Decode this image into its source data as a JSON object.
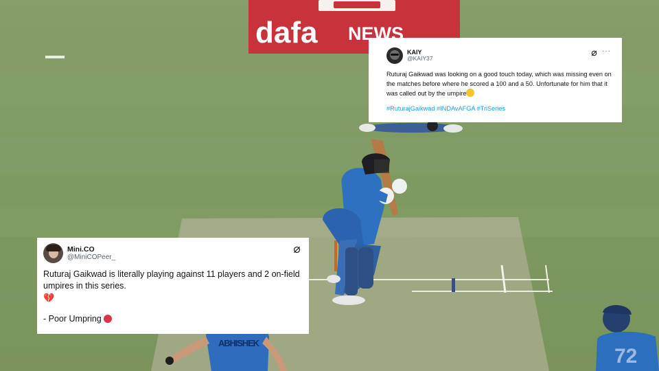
{
  "background": {
    "billboard_text": "dafaNEWS",
    "billboard_brand": "dafa",
    "billboard_suffix": "NEWS",
    "jersey_number": "72",
    "back_jersey_text": "ABHISHEK",
    "colors": {
      "grass": "#7f9a64",
      "billboard": "#c5303a",
      "jersey": "#2f74c0"
    }
  },
  "tweets": [
    {
      "id": "kaiy",
      "name": "KAIY",
      "handle": "@KAIY37",
      "body": "Ruturaj Gaikwad was looking on a good touch today, which was missing even on the matches before where he scored a 100 and a 50. Unfortunate for him that it was called out by the umpire",
      "emoji": "slightly-frowning-face",
      "hashtags": "#RuturajGaikwad #INDAvAFGA #TriSeries",
      "menu_icon": "more-dots-icon",
      "grok_icon": "grok-icon"
    },
    {
      "id": "minico",
      "name": "Mini.CO",
      "handle": "@MiniCOPeer_",
      "body": "Ruturaj Gaikwad is literally playing against 11 players and 2 on-field umpires in this series.",
      "emoji_line": "💔",
      "sign": "- Poor Umpring",
      "sign_emoji": "angry-face",
      "grok_icon": "grok-icon"
    }
  ]
}
